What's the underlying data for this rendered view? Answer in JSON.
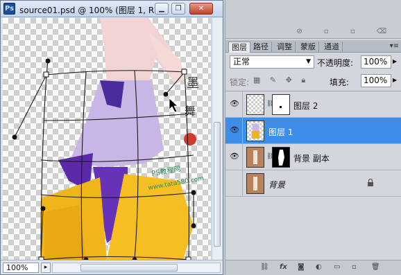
{
  "document": {
    "title": "source01.psd @ 100% (图层 1, R...",
    "app_icon": "Ps",
    "zoom": "100%",
    "window_buttons": [
      "minimize",
      "maximize",
      "close"
    ]
  },
  "layers_panel": {
    "tabs": [
      "图层",
      "路径",
      "调整",
      "蒙版",
      "通道"
    ],
    "active_tab": "图层",
    "blend_mode": "正常",
    "opacity_label": "不透明度:",
    "opacity_value": "100%",
    "lock_label": "锁定:",
    "fill_label": "填充:",
    "fill_value": "100%",
    "layers": [
      {
        "name": "图层 2",
        "visible": true,
        "selected": false,
        "has_mask": true
      },
      {
        "name": "图层 1",
        "visible": true,
        "selected": true,
        "has_mask": false
      },
      {
        "name": "背景 副本",
        "visible": true,
        "selected": false,
        "has_mask": true
      },
      {
        "name": "背景",
        "visible": false,
        "selected": false,
        "locked": true
      }
    ]
  },
  "watermark": "PS教程网 www.tata580.com",
  "colors": {
    "selection": "#3d8ee8",
    "titlebar": "#c5d6ec",
    "close_button": "#c0412a"
  }
}
